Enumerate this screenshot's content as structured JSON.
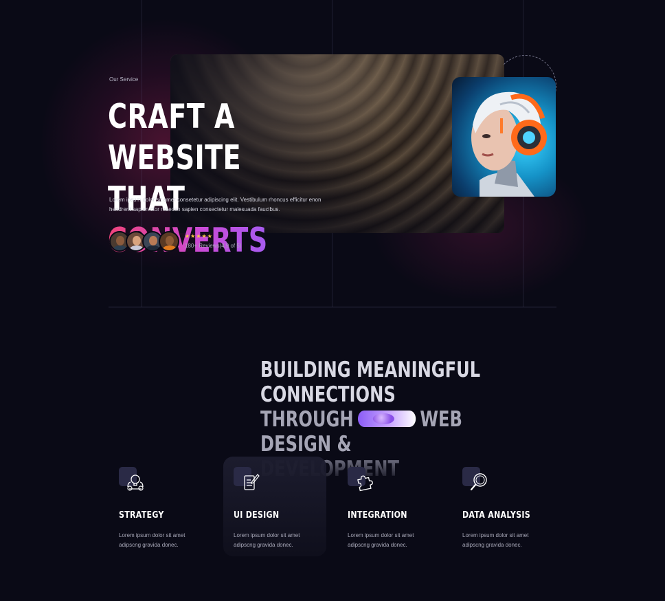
{
  "hero": {
    "eyebrow": "Our Service",
    "title_line1": "CRAFT A WEBSITE",
    "title_line2_plain": "THAT ",
    "title_line2_accent": "CONVERTS",
    "description": "Lorem ipsum dolor sit amet consetetur adipiscing elit. Vestibulum rhoncus efficitur enon hendrerit sapien ctor maecen sapien consectetur malesuada faucibus.",
    "rating_stars": "★★★★★",
    "reviews": "180+ Reviews(4.9 of 5)",
    "accent_gradient": [
      "#f0437b",
      "#c94bd8",
      "#a65cf0"
    ]
  },
  "statement": {
    "line1": "BUILDING MEANINGFUL CONNECTIONS",
    "line2_start": "THROUGH",
    "line2_end": "WEB DESIGN &",
    "line3": "DEVELOPMENT"
  },
  "services": [
    {
      "title": "STRATEGY",
      "icon": "strategy-bulb-gear-icon",
      "desc_line1": "Lorem ipsum dolor sit amet",
      "desc_line2": "adipscng gravida donec."
    },
    {
      "title": "UI DESIGN",
      "icon": "document-edit-icon",
      "desc_line1": "Lorem ipsum dolor sit amet",
      "desc_line2": "adipscng gravida donec."
    },
    {
      "title": "INTEGRATION",
      "icon": "puzzle-icon",
      "desc_line1": "Lorem ipsum dolor sit amet",
      "desc_line2": "adipscng gravida donec."
    },
    {
      "title": "DATA ANALYSIS",
      "icon": "magnifier-icon",
      "desc_line1": "Lorem ipsum dolor sit amet",
      "desc_line2": "adipscng gravida donec."
    }
  ],
  "colors": {
    "background": "#0a0a16",
    "star": "#f6c945",
    "icon_box": "#2a2a46"
  }
}
